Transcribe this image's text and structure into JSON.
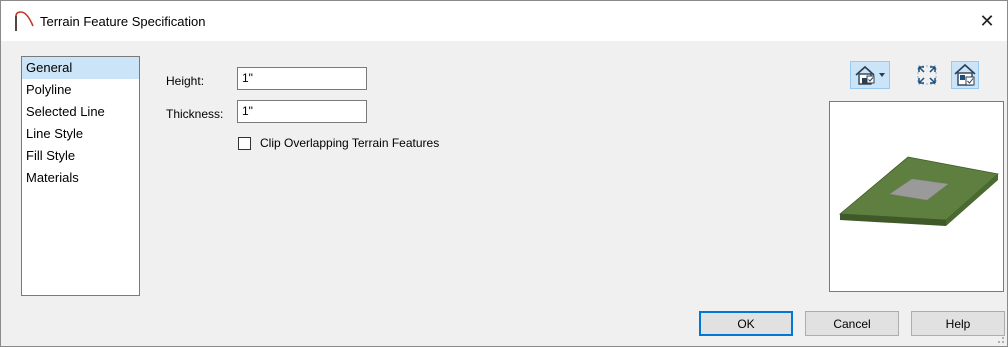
{
  "window": {
    "title": "Terrain Feature Specification",
    "close_glyph": "✕",
    "icon": "terrain-arc-icon"
  },
  "sidebar": {
    "items": [
      {
        "label": "General",
        "selected": true
      },
      {
        "label": "Polyline",
        "selected": false
      },
      {
        "label": "Selected Line",
        "selected": false
      },
      {
        "label": "Line Style",
        "selected": false
      },
      {
        "label": "Fill Style",
        "selected": false
      },
      {
        "label": "Materials",
        "selected": false
      }
    ]
  },
  "general": {
    "height_label": "Height:",
    "height_value": "1\"",
    "thickness_label": "Thickness:",
    "thickness_value": "1\"",
    "clip_label": "Clip Overlapping Terrain Features",
    "clip_checked": false
  },
  "preview_toolbar": {
    "view_button_icon": "house-view-icon",
    "fit_button_icon": "fill-window-icon",
    "render_button_icon": "render-preview-icon"
  },
  "buttons": {
    "ok": "OK",
    "cancel": "Cancel",
    "help": "Help"
  },
  "colors": {
    "selection": "#cce4f7",
    "terrain_green": "#5a7a3c",
    "feature_gray": "#9a9a9a",
    "default_button_border": "#0078d7"
  }
}
